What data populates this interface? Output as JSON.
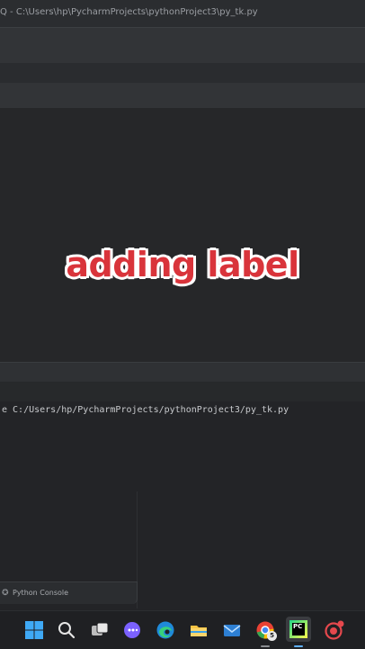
{
  "window": {
    "title": "Q - C:\\Users\\hp\\PycharmProjects\\pythonProject3\\py_tk.py"
  },
  "overlay": {
    "caption": "adding label"
  },
  "console": {
    "command_line": "e C:/Users/hp/PycharmProjects/pythonProject3/py_tk.py",
    "tab_label": "Python Console",
    "tab_icon": "python-console-icon"
  },
  "taskbar": {
    "icons": [
      "windows-start-icon",
      "search-icon",
      "task-view-icon",
      "teams-chat-icon",
      "edge-browser-icon",
      "file-explorer-icon",
      "mail-icon",
      "chrome-icon",
      "pycharm-icon",
      "record-app-icon"
    ],
    "pycharm_label": "PC",
    "chrome_badge": "5"
  },
  "colors": {
    "caption_fill": "#d9343b",
    "caption_outline": "#ffffff",
    "background": "#2b2d30"
  }
}
